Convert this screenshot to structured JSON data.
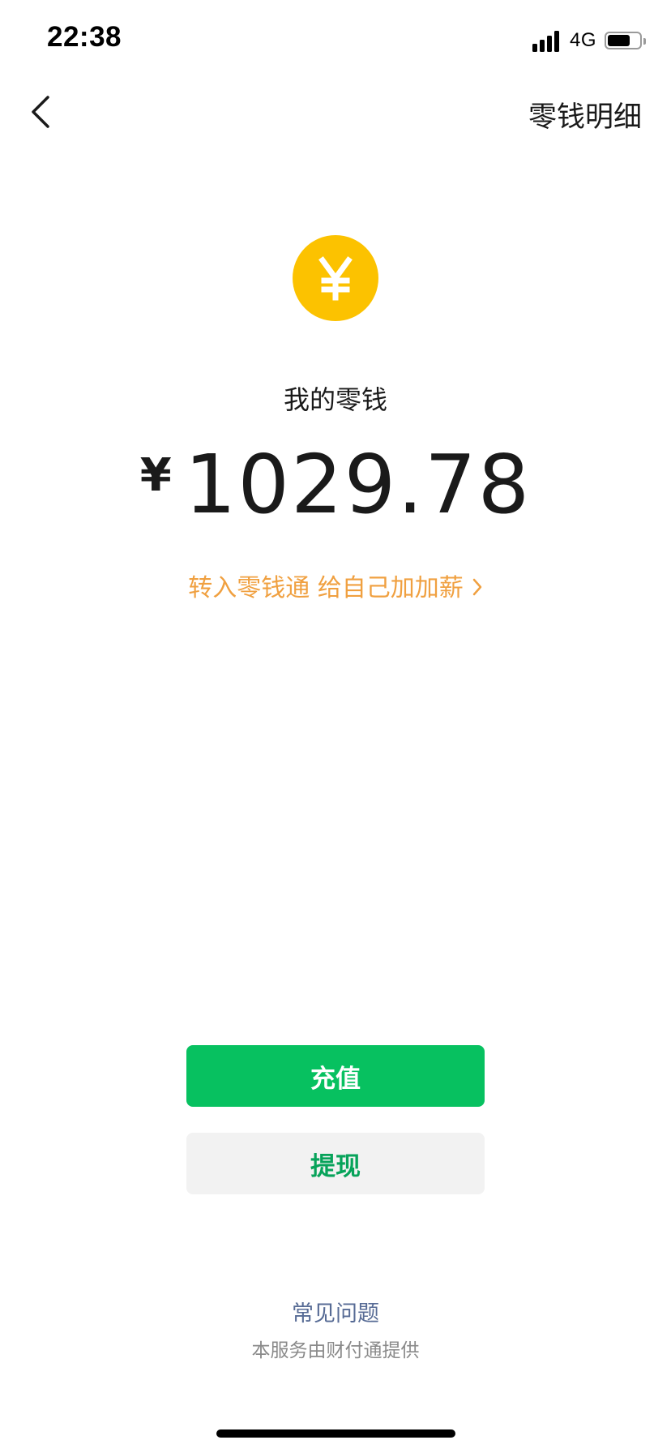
{
  "status_bar": {
    "time": "22:38",
    "network": "4G",
    "icons": [
      "signal-icon",
      "battery-icon"
    ],
    "battery_level_fraction": 0.7
  },
  "nav": {
    "back_icon": "chevron-left-icon",
    "right_action": "零钱明细"
  },
  "wallet": {
    "coin_icon": "yuan-coin-icon",
    "coin_symbol": "¥",
    "label": "我的零钱",
    "currency_symbol": "¥",
    "balance": "1029.78",
    "promo_text": "转入零钱通 给自己加加薪",
    "promo_icon": "chevron-right-icon"
  },
  "actions": {
    "recharge_label": "充值",
    "withdraw_label": "提现"
  },
  "footer": {
    "faq": "常见问题",
    "provider": "本服务由财付通提供"
  },
  "colors": {
    "accent_green": "#07c160",
    "coin_yellow": "#fcc200",
    "promo_orange": "#f0a040",
    "link_blue": "#576b95"
  }
}
